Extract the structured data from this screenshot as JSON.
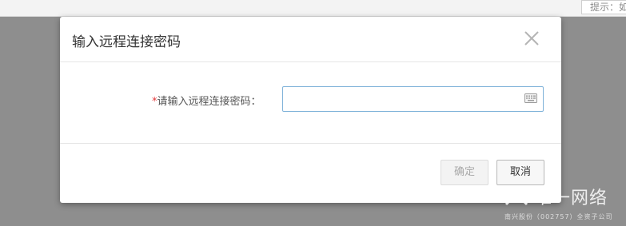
{
  "top": {
    "hint_text": "提示：如"
  },
  "dialog": {
    "title": "输入远程连接密码",
    "field": {
      "required_mark": "*",
      "label": "请输入远程连接密码：",
      "value": "",
      "placeholder": "",
      "keyboard_icon": "keyboard-icon"
    },
    "buttons": {
      "ok_label": "确定",
      "ok_state": "disabled",
      "cancel_label": "取消"
    },
    "close_icon": "close-icon"
  },
  "watermark": {
    "main": "唯一网络",
    "sub": "南兴股份（002757）全资子公司"
  },
  "colors": {
    "overlay": "#8e8e8e",
    "input_border_focus": "#7fb2d9",
    "required": "#e4393c"
  }
}
